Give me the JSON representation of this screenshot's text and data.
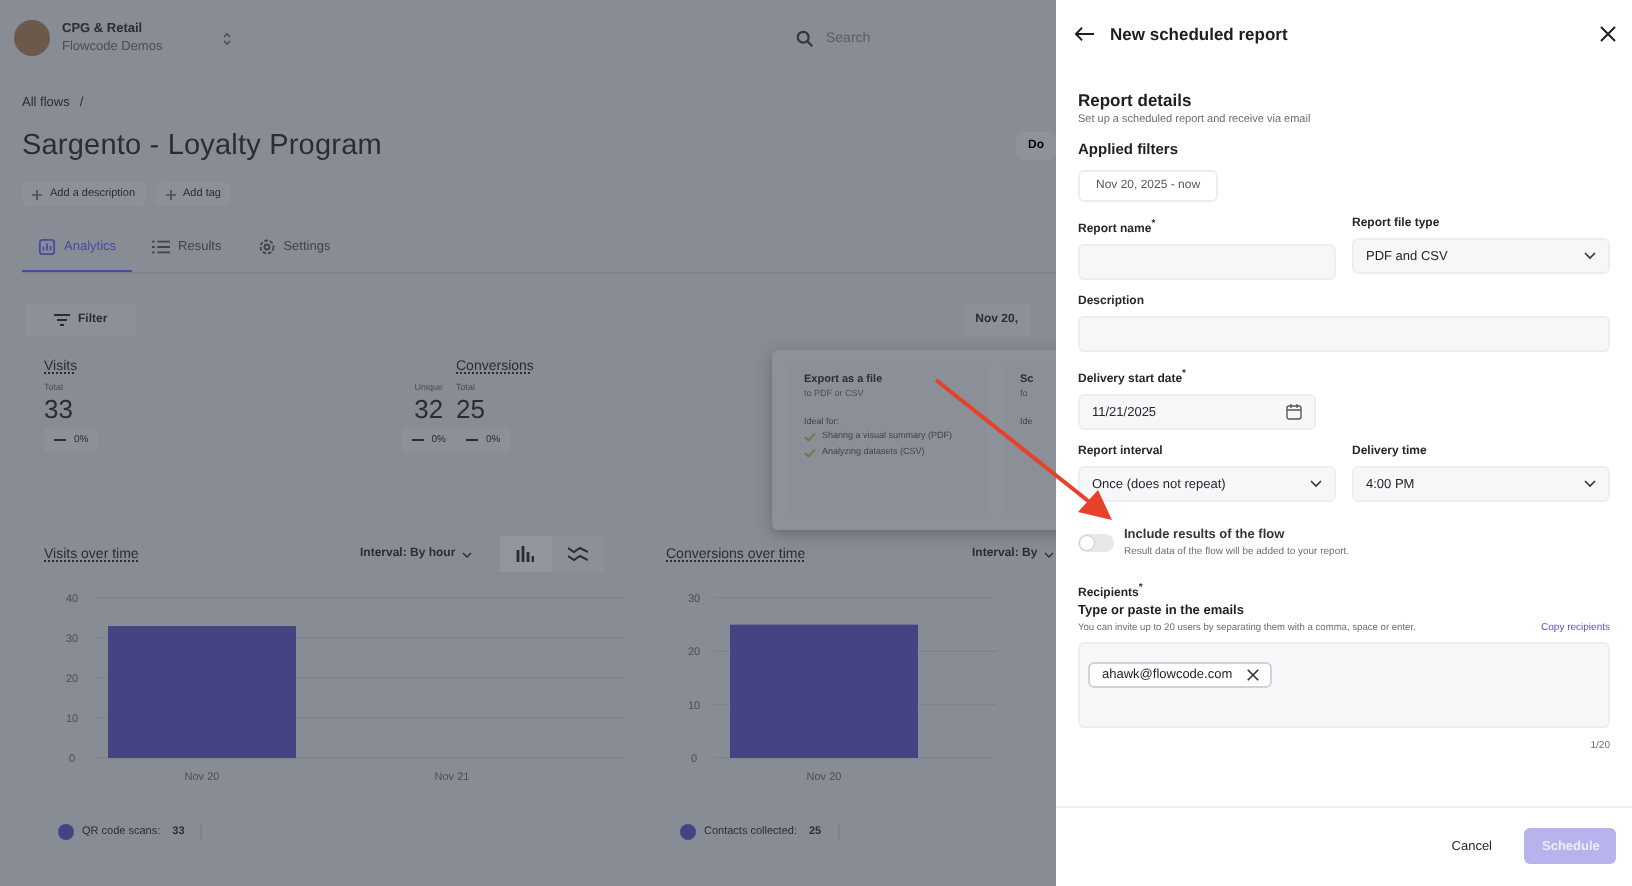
{
  "header": {
    "org": "CPG & Retail",
    "workspace": "Flowcode Demos",
    "search": {
      "placeholder": "Search"
    }
  },
  "breadcrumb": [
    "All flows",
    "/"
  ],
  "title": "Sargento - Loyalty Program",
  "header_button": "Do",
  "chips": [
    "Add a description",
    "Add tag"
  ],
  "tabs": [
    {
      "label": "Analytics",
      "selected": true
    },
    {
      "label": "Results",
      "selected": false
    },
    {
      "label": "Settings",
      "selected": false
    }
  ],
  "filter": "Filter",
  "date_range": "Nov 20,",
  "stats": [
    {
      "title": "Visits",
      "metrics": [
        {
          "label": "Total",
          "value": "33",
          "change": "0%"
        },
        {
          "label": "Unique",
          "value": "32",
          "change": "0%"
        }
      ]
    },
    {
      "title": "Conversions",
      "metrics": [
        {
          "label": "Total",
          "value": "25",
          "change": "0%"
        }
      ]
    }
  ],
  "export_options": [
    {
      "title": "Export as a file",
      "subtitle": "to PDF or CSV",
      "ideal_label": "Ideal for:",
      "items": [
        "Sharing a visual summary (PDF)",
        "Analyzing datasets (CSV)"
      ]
    },
    {
      "title": "Sc",
      "subtitle": "fo",
      "ideal_label": "Ide"
    }
  ],
  "charts": [
    {
      "title": "Visits over time",
      "interval": "Interval: By hour",
      "chart_data": {
        "type": "bar",
        "categories": [
          "Nov 20",
          "Nov 21"
        ],
        "values": [
          33,
          0
        ],
        "ylim": [
          0,
          40
        ],
        "yticks": [
          0,
          10,
          20,
          30,
          40
        ]
      },
      "legend": {
        "label": "QR code scans:",
        "value": "33",
        "color": "#444484"
      }
    },
    {
      "title": "Conversions over time",
      "interval": "Interval: By",
      "chart_data": {
        "type": "bar",
        "categories": [
          "Nov 20"
        ],
        "values": [
          25
        ],
        "ylim": [
          0,
          30
        ],
        "yticks": [
          0,
          10,
          20,
          30
        ]
      },
      "legend": {
        "label": "Contacts collected:",
        "value": "25",
        "color": "#444484"
      }
    }
  ],
  "drawer": {
    "title": "New scheduled report",
    "section_title": "Report details",
    "section_subtitle": "Set up a scheduled report and receive via email",
    "filters_title": "Applied filters",
    "filter_chip": "Nov 20, 2025 - now",
    "field_rows": [
      [
        {
          "kind": "text",
          "label": "Report name$^{*}$"
        },
        {
          "kind": "select",
          "label": "Report file type",
          "value": "PDF and CSV"
        }
      ],
      [
        {
          "kind": "text",
          "label": "Description"
        }
      ],
      [
        {
          "kind": "date",
          "label": "Delivery start date$^{*}$",
          "value": "11/21/2025"
        }
      ],
      [
        {
          "kind": "select",
          "label": "Report interval",
          "value": "Once (does not repeat)"
        },
        {
          "kind": "select",
          "label": "Delivery time",
          "value": "4:00 PM"
        }
      ]
    ],
    "toggle": {
      "label": "Include results of the flow",
      "hint": "Result data of the flow will be added to your report.",
      "on": false
    },
    "recipients": {
      "label": "Recipients$^{*}$",
      "title": "Type or paste in the emails",
      "hint": "You can invite up to 20 users by separating them with a comma, space or enter.",
      "link": "Copy recipients",
      "emails": [
        "ahawk@flowcode.com"
      ],
      "count": "1/20"
    },
    "cancel": "Cancel",
    "schedule": {
      "label": "Schedule",
      "disabled": true
    }
  }
}
